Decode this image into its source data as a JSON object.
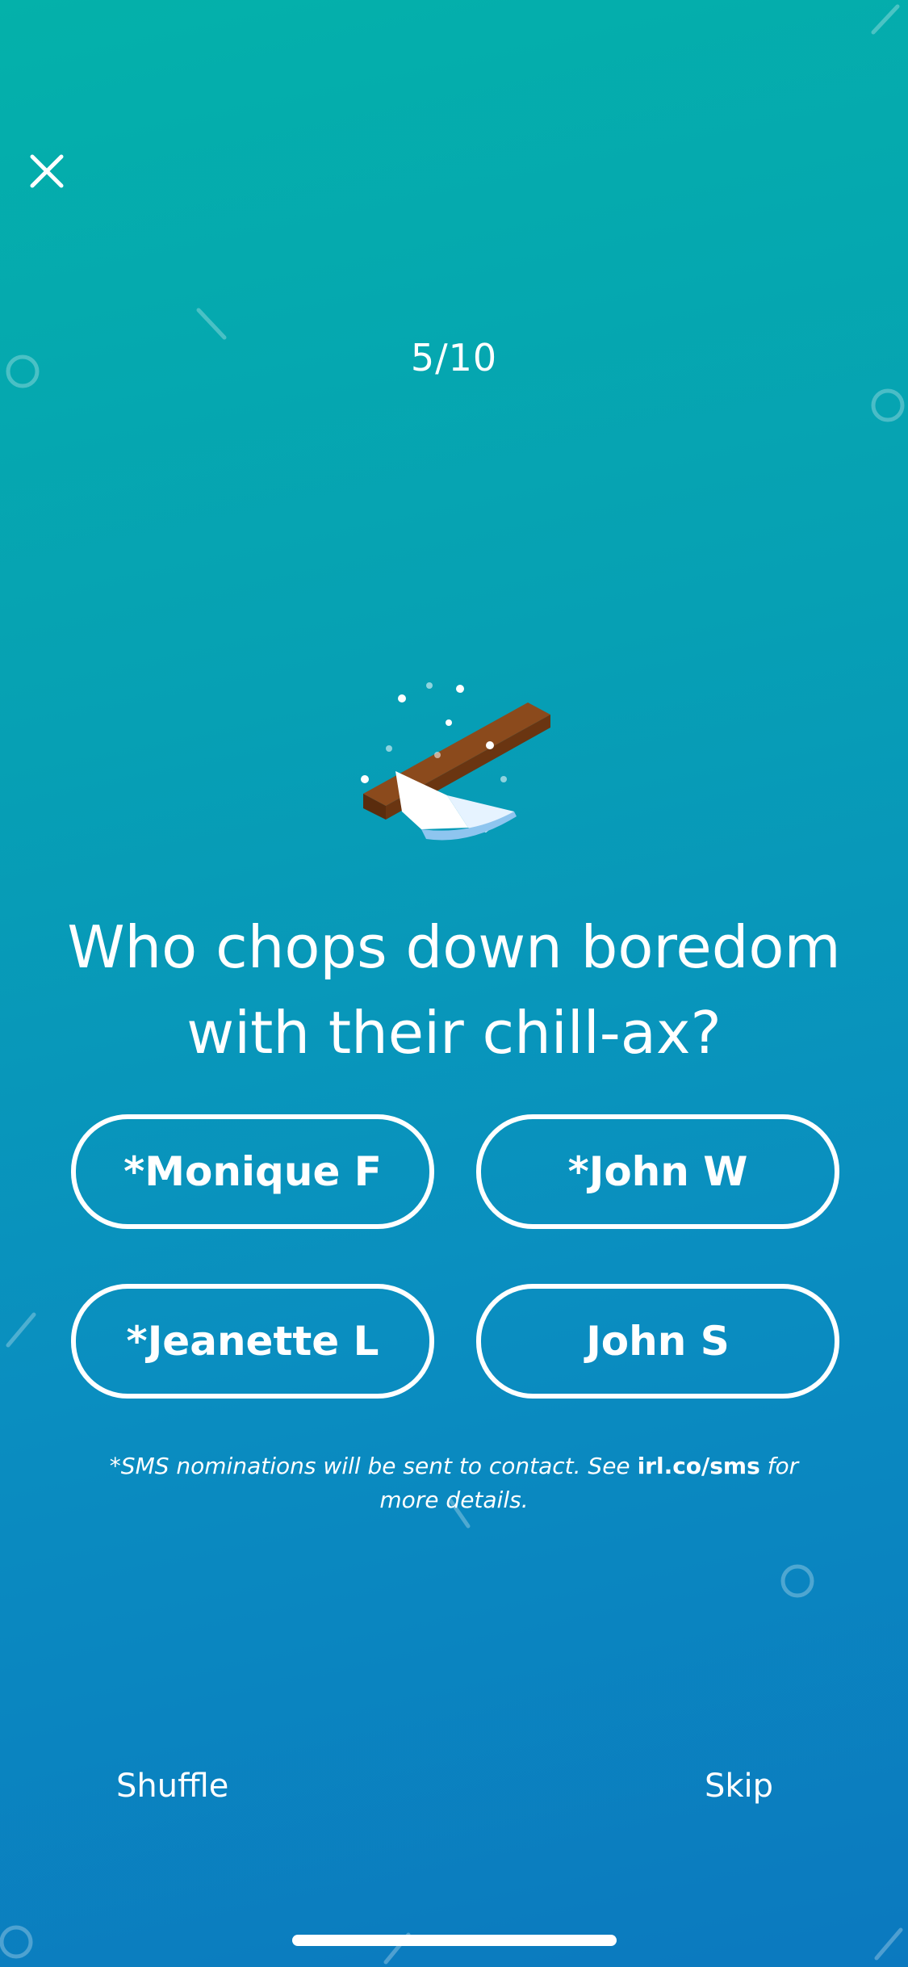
{
  "header": {
    "close_icon": "close-icon",
    "progress": "5/10"
  },
  "question": {
    "illustration_icon": "axe-icon",
    "line1": "Who chops down boredom",
    "line2": "with their chill-ax?"
  },
  "options": [
    {
      "label": "*Monique F"
    },
    {
      "label": "*John W"
    },
    {
      "label": "*Jeanette L"
    },
    {
      "label": "John S"
    }
  ],
  "disclaimer": {
    "prefix": "*SMS nominations will be sent to contact. See ",
    "link": "irl.co/sms",
    "suffix": " for more details."
  },
  "footer": {
    "shuffle_label": "Shuffle",
    "skip_label": "Skip"
  },
  "colors": {
    "gradient_top": "#04b1aa",
    "gradient_bottom": "#0b79bf",
    "text": "#ffffff"
  }
}
